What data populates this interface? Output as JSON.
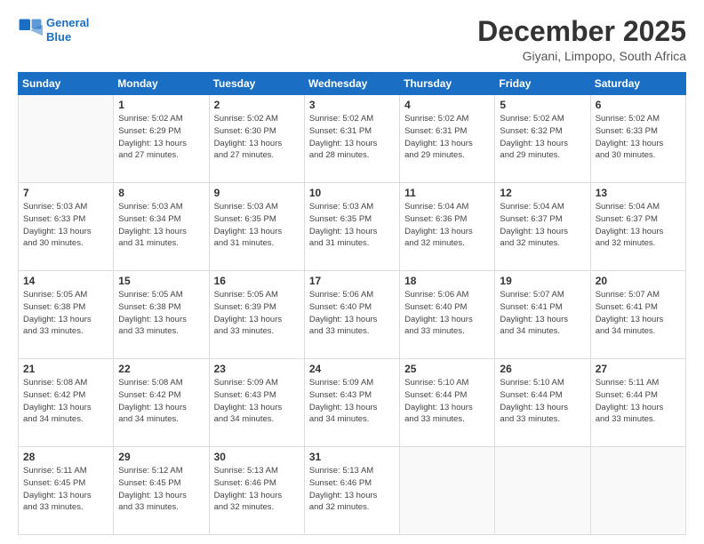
{
  "logo": {
    "line1": "General",
    "line2": "Blue"
  },
  "header": {
    "month": "December 2025",
    "location": "Giyani, Limpopo, South Africa"
  },
  "days_of_week": [
    "Sunday",
    "Monday",
    "Tuesday",
    "Wednesday",
    "Thursday",
    "Friday",
    "Saturday"
  ],
  "weeks": [
    [
      {
        "day": "",
        "info": ""
      },
      {
        "day": "1",
        "info": "Sunrise: 5:02 AM\nSunset: 6:29 PM\nDaylight: 13 hours\nand 27 minutes."
      },
      {
        "day": "2",
        "info": "Sunrise: 5:02 AM\nSunset: 6:30 PM\nDaylight: 13 hours\nand 27 minutes."
      },
      {
        "day": "3",
        "info": "Sunrise: 5:02 AM\nSunset: 6:31 PM\nDaylight: 13 hours\nand 28 minutes."
      },
      {
        "day": "4",
        "info": "Sunrise: 5:02 AM\nSunset: 6:31 PM\nDaylight: 13 hours\nand 29 minutes."
      },
      {
        "day": "5",
        "info": "Sunrise: 5:02 AM\nSunset: 6:32 PM\nDaylight: 13 hours\nand 29 minutes."
      },
      {
        "day": "6",
        "info": "Sunrise: 5:02 AM\nSunset: 6:33 PM\nDaylight: 13 hours\nand 30 minutes."
      }
    ],
    [
      {
        "day": "7",
        "info": "Sunrise: 5:03 AM\nSunset: 6:33 PM\nDaylight: 13 hours\nand 30 minutes."
      },
      {
        "day": "8",
        "info": "Sunrise: 5:03 AM\nSunset: 6:34 PM\nDaylight: 13 hours\nand 31 minutes."
      },
      {
        "day": "9",
        "info": "Sunrise: 5:03 AM\nSunset: 6:35 PM\nDaylight: 13 hours\nand 31 minutes."
      },
      {
        "day": "10",
        "info": "Sunrise: 5:03 AM\nSunset: 6:35 PM\nDaylight: 13 hours\nand 31 minutes."
      },
      {
        "day": "11",
        "info": "Sunrise: 5:04 AM\nSunset: 6:36 PM\nDaylight: 13 hours\nand 32 minutes."
      },
      {
        "day": "12",
        "info": "Sunrise: 5:04 AM\nSunset: 6:37 PM\nDaylight: 13 hours\nand 32 minutes."
      },
      {
        "day": "13",
        "info": "Sunrise: 5:04 AM\nSunset: 6:37 PM\nDaylight: 13 hours\nand 32 minutes."
      }
    ],
    [
      {
        "day": "14",
        "info": "Sunrise: 5:05 AM\nSunset: 6:38 PM\nDaylight: 13 hours\nand 33 minutes."
      },
      {
        "day": "15",
        "info": "Sunrise: 5:05 AM\nSunset: 6:38 PM\nDaylight: 13 hours\nand 33 minutes."
      },
      {
        "day": "16",
        "info": "Sunrise: 5:05 AM\nSunset: 6:39 PM\nDaylight: 13 hours\nand 33 minutes."
      },
      {
        "day": "17",
        "info": "Sunrise: 5:06 AM\nSunset: 6:40 PM\nDaylight: 13 hours\nand 33 minutes."
      },
      {
        "day": "18",
        "info": "Sunrise: 5:06 AM\nSunset: 6:40 PM\nDaylight: 13 hours\nand 33 minutes."
      },
      {
        "day": "19",
        "info": "Sunrise: 5:07 AM\nSunset: 6:41 PM\nDaylight: 13 hours\nand 34 minutes."
      },
      {
        "day": "20",
        "info": "Sunrise: 5:07 AM\nSunset: 6:41 PM\nDaylight: 13 hours\nand 34 minutes."
      }
    ],
    [
      {
        "day": "21",
        "info": "Sunrise: 5:08 AM\nSunset: 6:42 PM\nDaylight: 13 hours\nand 34 minutes."
      },
      {
        "day": "22",
        "info": "Sunrise: 5:08 AM\nSunset: 6:42 PM\nDaylight: 13 hours\nand 34 minutes."
      },
      {
        "day": "23",
        "info": "Sunrise: 5:09 AM\nSunset: 6:43 PM\nDaylight: 13 hours\nand 34 minutes."
      },
      {
        "day": "24",
        "info": "Sunrise: 5:09 AM\nSunset: 6:43 PM\nDaylight: 13 hours\nand 34 minutes."
      },
      {
        "day": "25",
        "info": "Sunrise: 5:10 AM\nSunset: 6:44 PM\nDaylight: 13 hours\nand 33 minutes."
      },
      {
        "day": "26",
        "info": "Sunrise: 5:10 AM\nSunset: 6:44 PM\nDaylight: 13 hours\nand 33 minutes."
      },
      {
        "day": "27",
        "info": "Sunrise: 5:11 AM\nSunset: 6:44 PM\nDaylight: 13 hours\nand 33 minutes."
      }
    ],
    [
      {
        "day": "28",
        "info": "Sunrise: 5:11 AM\nSunset: 6:45 PM\nDaylight: 13 hours\nand 33 minutes."
      },
      {
        "day": "29",
        "info": "Sunrise: 5:12 AM\nSunset: 6:45 PM\nDaylight: 13 hours\nand 33 minutes."
      },
      {
        "day": "30",
        "info": "Sunrise: 5:13 AM\nSunset: 6:46 PM\nDaylight: 13 hours\nand 32 minutes."
      },
      {
        "day": "31",
        "info": "Sunrise: 5:13 AM\nSunset: 6:46 PM\nDaylight: 13 hours\nand 32 minutes."
      },
      {
        "day": "",
        "info": ""
      },
      {
        "day": "",
        "info": ""
      },
      {
        "day": "",
        "info": ""
      }
    ]
  ]
}
